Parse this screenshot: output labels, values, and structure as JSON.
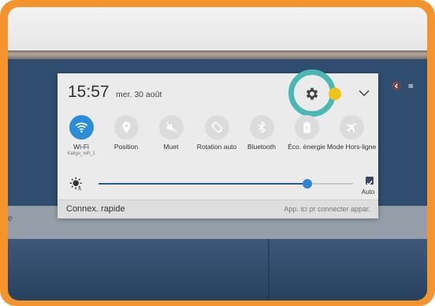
{
  "panel": {
    "time": "15:57",
    "date": "mer. 30 août",
    "toggles": [
      {
        "label": "Wi-Fi",
        "sub": "Kaligo_wifi_1",
        "icon": "wifi-icon",
        "on": true
      },
      {
        "label": "Position",
        "sub": "",
        "icon": "location-icon",
        "on": false
      },
      {
        "label": "Muet",
        "sub": "",
        "icon": "mute-icon",
        "on": false
      },
      {
        "label": "Rotation auto",
        "sub": "",
        "icon": "rotation-icon",
        "on": false
      },
      {
        "label": "Bluetooth",
        "sub": "",
        "icon": "bluetooth-icon",
        "on": false
      },
      {
        "label": "Éco. énergie",
        "sub": "",
        "icon": "battery-icon",
        "on": false
      },
      {
        "label": "Mode Hors-ligne",
        "sub": "",
        "icon": "airplane-icon",
        "on": false
      }
    ],
    "brightness": {
      "level": 0.82,
      "auto_checked": true,
      "auto_label": "Auto"
    },
    "footer": {
      "left": "Connex. rapide",
      "right": "App. ici pr connecter appar."
    }
  },
  "screen": {
    "left_fragment": "e"
  },
  "colors": {
    "frame": "#f5932c",
    "highlight": "#49b8b4",
    "accent": "#2b8cd8"
  }
}
